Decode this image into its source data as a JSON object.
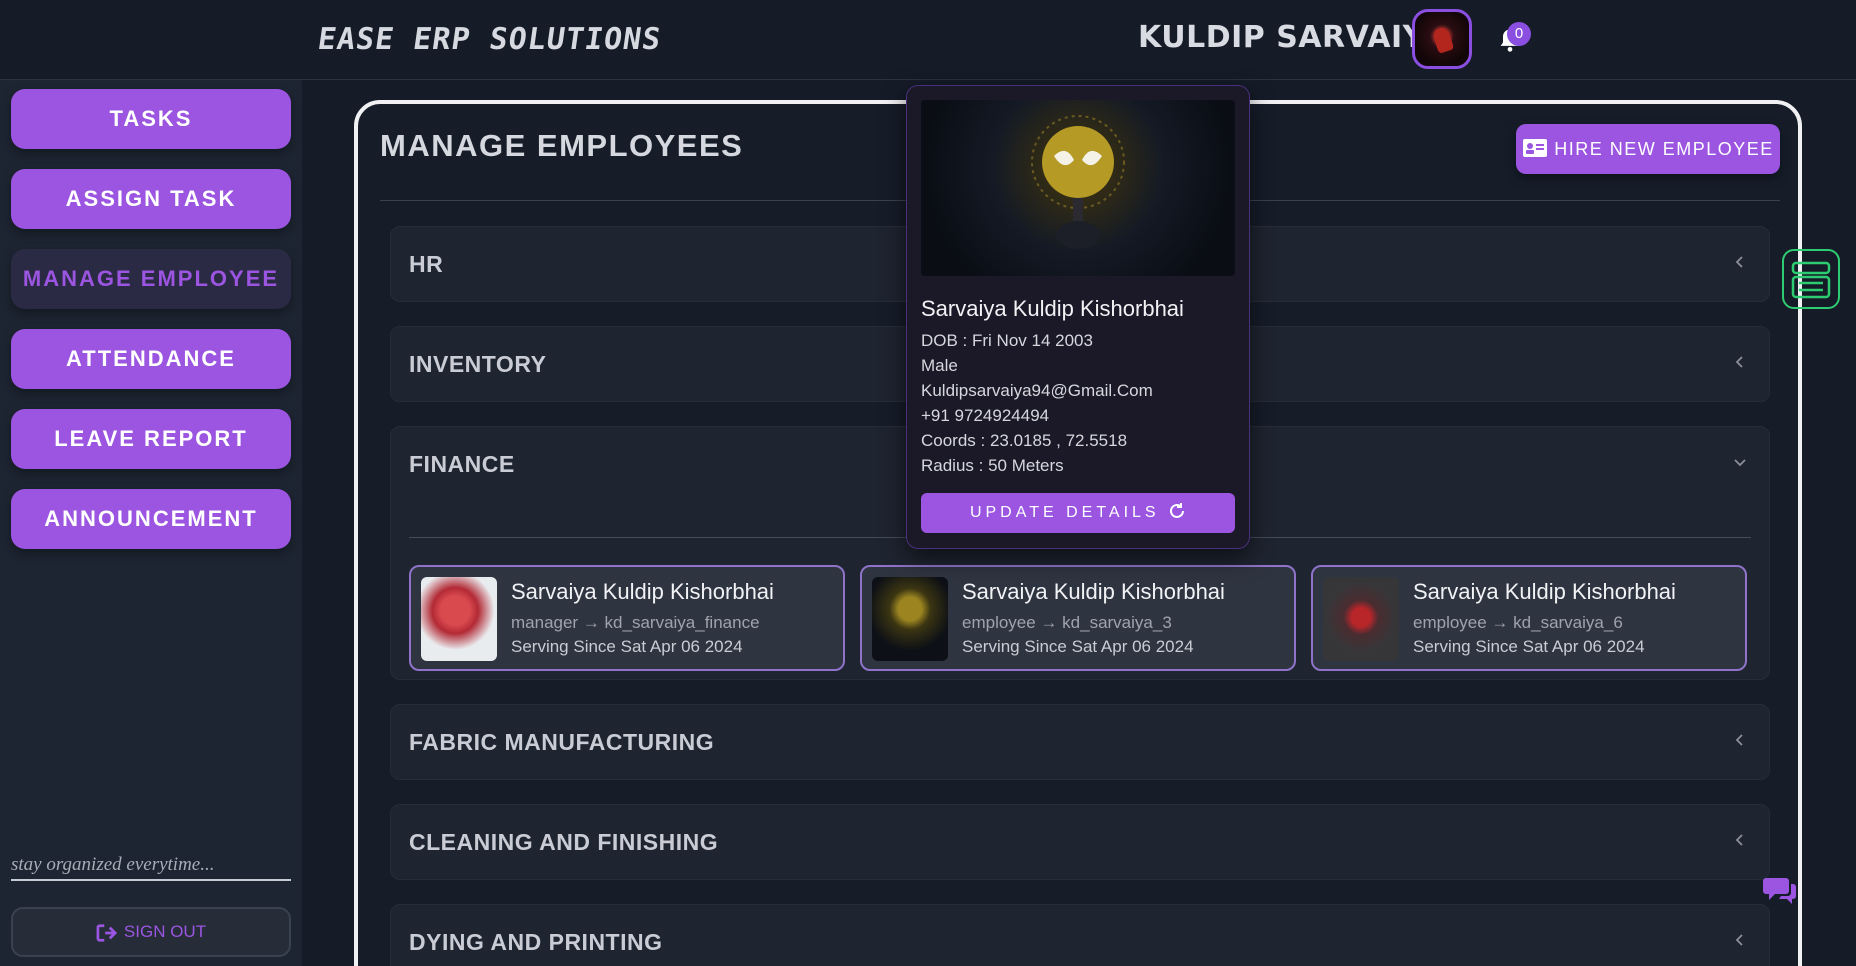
{
  "header": {
    "brand": "EASE ERP SOLUTIONS",
    "user_name": "KULDIP SARVAIYA",
    "notification_count": "0"
  },
  "sidebar": {
    "items": [
      {
        "label": "TASKS",
        "active": false
      },
      {
        "label": "ASSIGN TASK",
        "active": false
      },
      {
        "label": "MANAGE EMPLOYEE",
        "active": true
      },
      {
        "label": "ATTENDANCE",
        "active": false
      },
      {
        "label": "LEAVE REPORT",
        "active": false
      },
      {
        "label": "ANNOUNCEMENT",
        "active": false
      }
    ],
    "tagline": "stay organized everytime...",
    "signout_label": "SIGN OUT"
  },
  "main": {
    "title": "MANAGE EMPLOYEES",
    "hire_button": "HIRE NEW EMPLOYEE",
    "departments": [
      {
        "label": "HR",
        "expanded": false
      },
      {
        "label": "INVENTORY",
        "expanded": false
      },
      {
        "label": "FINANCE",
        "expanded": true
      },
      {
        "label": "FABRIC MANUFACTURING",
        "expanded": false
      },
      {
        "label": "CLEANING AND FINISHING",
        "expanded": false
      },
      {
        "label": "DYING AND PRINTING",
        "expanded": false
      }
    ],
    "finance_employees": [
      {
        "name": "Sarvaiya Kuldip Kishorbhai",
        "role": "manager → kd_sarvaiya_finance",
        "since": "Serving Since Sat Apr 06 2024"
      },
      {
        "name": "Sarvaiya Kuldip Kishorbhai",
        "role": "employee → kd_sarvaiya_3",
        "since": "Serving Since Sat Apr 06 2024"
      },
      {
        "name": "Sarvaiya Kuldip Kishorbhai",
        "role": "employee → kd_sarvaiya_6",
        "since": "Serving Since Sat Apr 06 2024"
      }
    ]
  },
  "popup": {
    "name": "Sarvaiya Kuldip Kishorbhai",
    "dob": "DOB : Fri Nov 14 2003",
    "gender": "Male",
    "email": "Kuldipsarvaiya94@Gmail.Com",
    "phone": "+91 9724924494",
    "coords": "Coords : 23.0185 , 72.5518",
    "radius": "Radius : 50 Meters",
    "button": "UPDATE DETAILS"
  },
  "colors": {
    "accent": "#9b55e0",
    "background": "#151c28",
    "sidebar": "#1d2532",
    "float_icon": "#2ecc71"
  }
}
